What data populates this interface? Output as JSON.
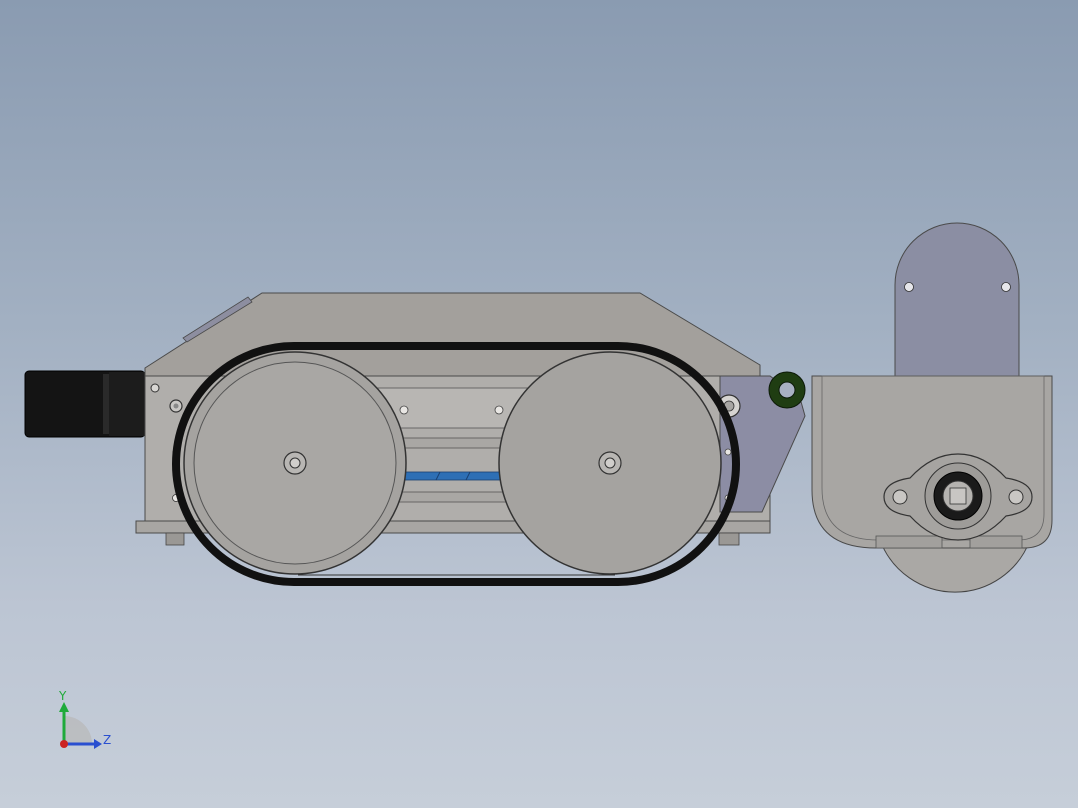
{
  "viewport": {
    "background_top": "#8a9bb1",
    "background_bottom": "#c6ced9"
  },
  "model": {
    "part_color": "#a19f9d",
    "belt_color": "#111111",
    "bracket_color": "#8a8aa0",
    "motor_color": "#1a1a1a",
    "accent_color": "#2e6fb5",
    "ring_color": "#1f3d12"
  },
  "triad": {
    "y_label": "Y",
    "z_label": "Z",
    "y_color": "#1faa3a",
    "z_color": "#2a4fd0",
    "x_color": "#cc2222"
  }
}
